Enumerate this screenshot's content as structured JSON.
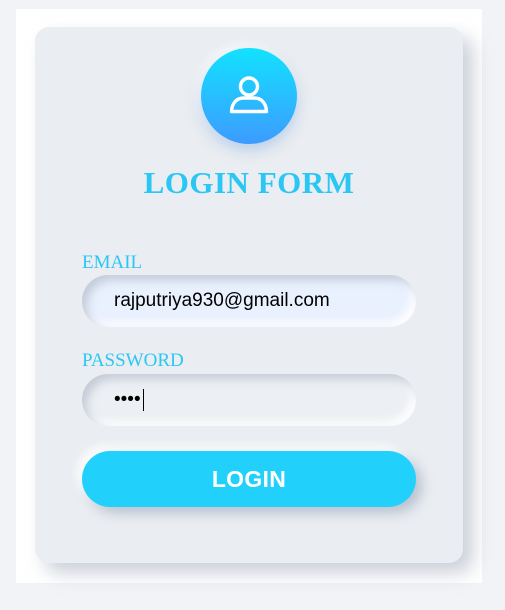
{
  "form": {
    "title": "LOGIN FORM",
    "avatar_icon": "user-icon",
    "email": {
      "label": "EMAIL",
      "value": "rajputriya930@gmail.com"
    },
    "password": {
      "label": "PASSWORD",
      "masked_value": "••••"
    },
    "login_label": "LOGIN"
  },
  "colors": {
    "accent": "#2bc7f4",
    "button": "#22d1fb",
    "card": "#eaedf1",
    "avatar_top": "#12e2ff",
    "avatar_bottom": "#3d9bff"
  }
}
